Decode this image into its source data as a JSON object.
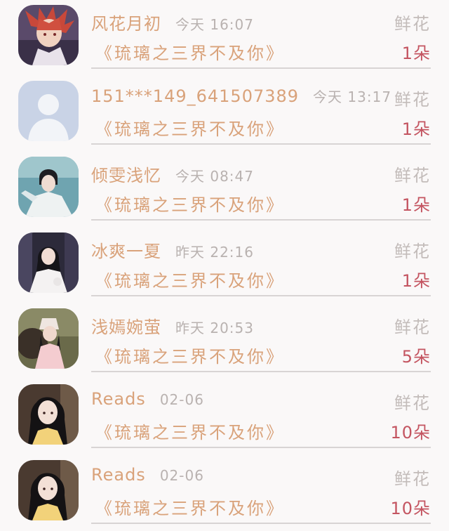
{
  "rows": [
    {
      "name": "风花月初",
      "time": "今天 16:07",
      "gift": "鲜花",
      "book": "《琉璃之三界不及你》",
      "count": "1朵",
      "avatar": "anime-avatar"
    },
    {
      "name": "151***149_641507389",
      "time": "今天 13:17",
      "gift": "鲜花",
      "book": "《琉璃之三界不及你》",
      "count": "1朵",
      "avatar": "default-avatar"
    },
    {
      "name": "倾雯浅忆",
      "time": "今天 08:47",
      "gift": "鲜花",
      "book": "《琉璃之三界不及你》",
      "count": "1朵",
      "avatar": "photo-avatar"
    },
    {
      "name": "冰爽一夏",
      "time": "昨天 22:16",
      "gift": "鲜花",
      "book": "《琉璃之三界不及你》",
      "count": "1朵",
      "avatar": "photo-avatar"
    },
    {
      "name": "浅嫣婉萤",
      "time": "昨天 20:53",
      "gift": "鲜花",
      "book": "《琉璃之三界不及你》",
      "count": "5朵",
      "avatar": "photo-avatar"
    },
    {
      "name": "Reads",
      "time": "02-06",
      "gift": "鲜花",
      "book": "《琉璃之三界不及你》",
      "count": "10朵",
      "avatar": "photo-avatar"
    },
    {
      "name": "Reads",
      "time": "02-06",
      "gift": "鲜花",
      "book": "《琉璃之三界不及你》",
      "count": "10朵",
      "avatar": "photo-avatar"
    }
  ],
  "colors": {
    "name": "#d9a27a",
    "time": "#b9b2b0",
    "gift": "#c3bcba",
    "count": "#c45561",
    "divider": "#d8d4d4"
  }
}
